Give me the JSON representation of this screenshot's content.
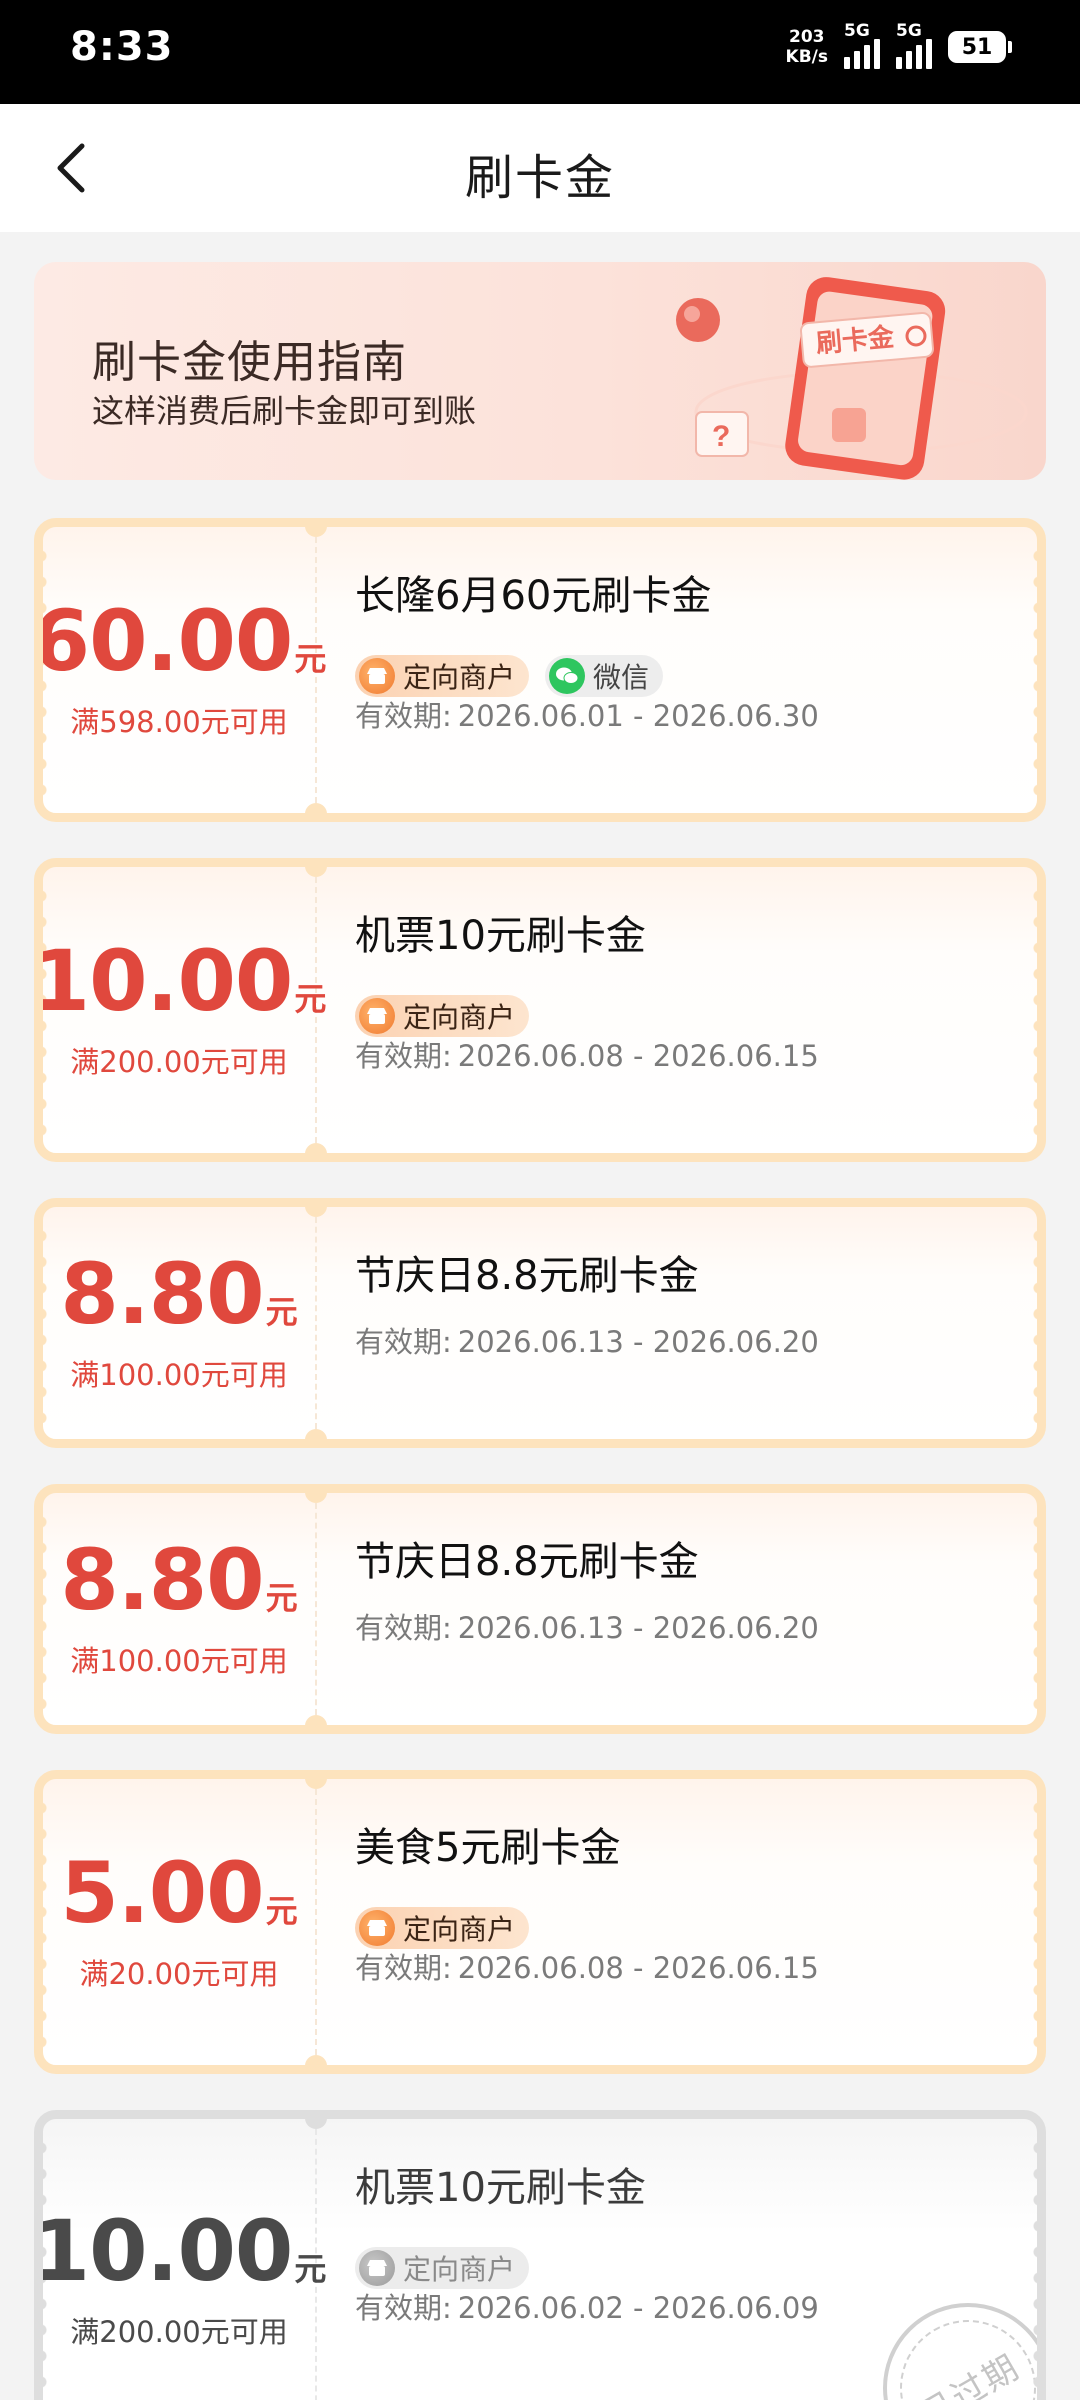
{
  "status_bar": {
    "time": "8:33",
    "net_speed_value": "203",
    "net_speed_unit": "KB/s",
    "signal_1_label": "5G",
    "signal_2_label": "5G",
    "battery": "51"
  },
  "nav": {
    "title": "刷卡金",
    "back_icon": "chevron-left-icon"
  },
  "guide": {
    "title": "刷卡金使用指南",
    "subtitle": "这样消费后刷卡金即可到账",
    "art_label": "刷卡金"
  },
  "coupons": [
    {
      "amount": "60.00",
      "unit": "元",
      "threshold": "满598.00元可用",
      "name": "长隆6月60元刷卡金",
      "tags": [
        "定向商户",
        "微信"
      ],
      "validity_label": "有效期:",
      "validity": "2026.06.01 - 2026.06.30",
      "expired": false
    },
    {
      "amount": "10.00",
      "unit": "元",
      "threshold": "满200.00元可用",
      "name": "机票10元刷卡金",
      "tags": [
        "定向商户"
      ],
      "validity_label": "有效期:",
      "validity": "2026.06.08 - 2026.06.15",
      "expired": false
    },
    {
      "amount": "8.80",
      "unit": "元",
      "threshold": "满100.00元可用",
      "name": "节庆日8.8元刷卡金",
      "tags": [],
      "validity_label": "有效期:",
      "validity": "2026.06.13 - 2026.06.20",
      "expired": false
    },
    {
      "amount": "8.80",
      "unit": "元",
      "threshold": "满100.00元可用",
      "name": "节庆日8.8元刷卡金",
      "tags": [],
      "validity_label": "有效期:",
      "validity": "2026.06.13 - 2026.06.20",
      "expired": false
    },
    {
      "amount": "5.00",
      "unit": "元",
      "threshold": "满20.00元可用",
      "name": "美食5元刷卡金",
      "tags": [
        "定向商户"
      ],
      "validity_label": "有效期:",
      "validity": "2026.06.08 - 2026.06.15",
      "expired": false
    },
    {
      "amount": "10.00",
      "unit": "元",
      "threshold": "满200.00元可用",
      "name": "机票10元刷卡金",
      "tags": [
        "定向商户"
      ],
      "validity_label": "有效期:",
      "validity": "2026.06.02 - 2026.06.09",
      "expired": true,
      "stamp": "已过期"
    }
  ],
  "colors": {
    "accent_red": "#e0483d",
    "coupon_border": "#fde3bd",
    "expired_gray": "#dedede",
    "status_bar_bg": "#000000"
  }
}
